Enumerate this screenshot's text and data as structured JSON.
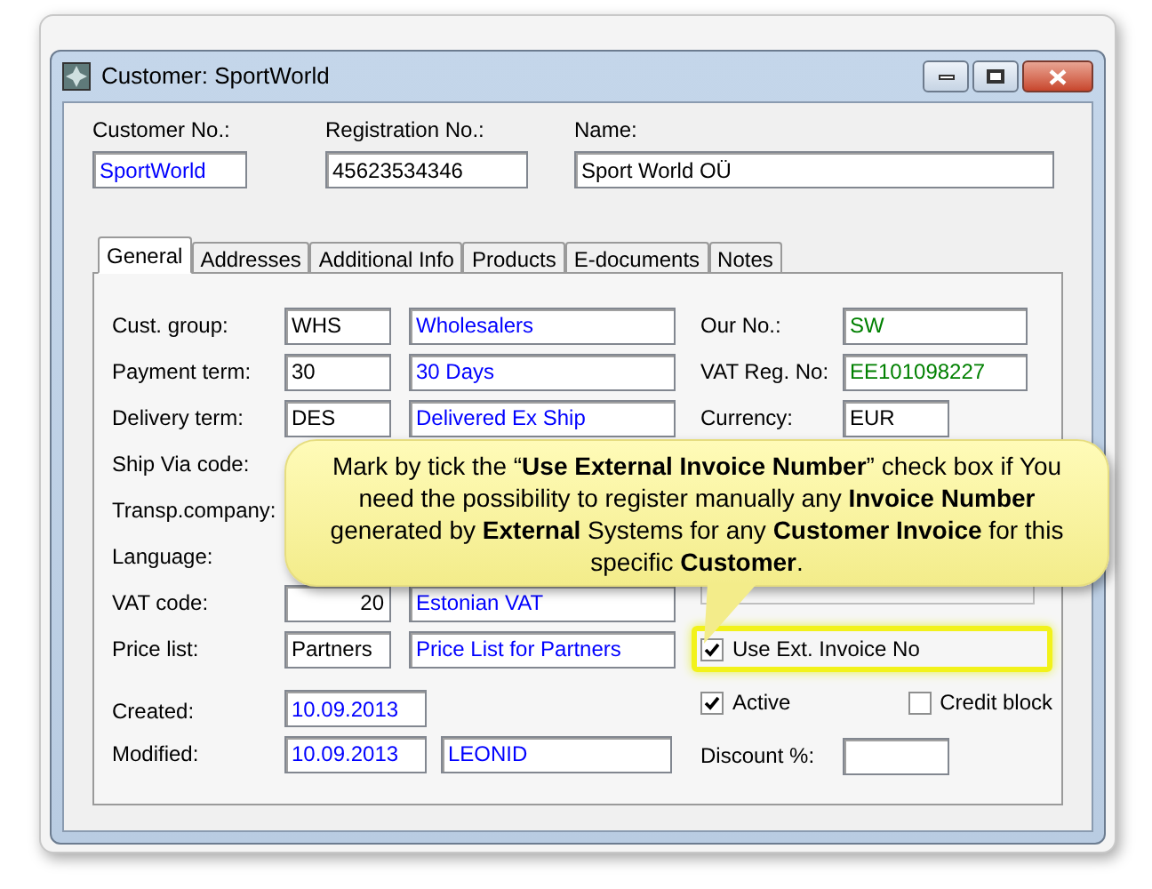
{
  "window": {
    "title": "Customer: SportWorld"
  },
  "header_fields": [
    {
      "label": "Customer No.:",
      "value": "SportWorld",
      "color": "#0000ff"
    },
    {
      "label": "Registration No.:",
      "value": "45623534346",
      "color": "#000000"
    },
    {
      "label": "Name:",
      "value": "Sport World OÜ",
      "color": "#000000"
    }
  ],
  "tabs": [
    {
      "label": "General",
      "selected": true
    },
    {
      "label": "Addresses",
      "selected": false
    },
    {
      "label": "Additional Info",
      "selected": false
    },
    {
      "label": "Products",
      "selected": false
    },
    {
      "label": "E-documents",
      "selected": false
    },
    {
      "label": "Notes",
      "selected": false
    }
  ],
  "left_rows": [
    {
      "label": "Cust. group:",
      "code": {
        "value": "WHS",
        "color": "#000000"
      },
      "description": {
        "value": "Wholesalers",
        "color": "#0000ff"
      }
    },
    {
      "label": "Payment term:",
      "code": {
        "value": "30",
        "color": "#000000"
      },
      "description": {
        "value": "30 Days",
        "color": "#0000ff"
      }
    },
    {
      "label": "Delivery term:",
      "code": {
        "value": "DES",
        "color": "#000000"
      },
      "description": {
        "value": "Delivered Ex Ship",
        "color": "#0000ff"
      }
    },
    {
      "label": "Ship Via code:"
    },
    {
      "label": "Transp.company:"
    },
    {
      "label": "Language:"
    },
    {
      "label": "VAT code:",
      "code": {
        "value": "20",
        "color": "#000000",
        "kind": "number"
      },
      "description": {
        "value": "Estonian VAT",
        "color": "#0000ff"
      }
    },
    {
      "label": "Price list:",
      "code": {
        "value": "Partners",
        "color": "#000000"
      },
      "description": {
        "value": "Price List for Partners",
        "color": "#0000ff"
      }
    }
  ],
  "created": {
    "label": "Created:",
    "value": "10.09.2013"
  },
  "modified": {
    "label": "Modified:",
    "value": "10.09.2013",
    "user": "LEONID"
  },
  "right_fields": [
    {
      "label": "Our No.:",
      "value": "SW",
      "color": "#008000"
    },
    {
      "label": "VAT Reg. No:",
      "value": "EE101098227",
      "color": "#008000"
    },
    {
      "label": "Currency:",
      "value": "EUR",
      "color": "#000000"
    }
  ],
  "checkboxes": [
    {
      "label": "Use Ext. Invoice No",
      "checked": true,
      "highlighted": true
    },
    {
      "label": "Active",
      "checked": true,
      "highlighted": false
    },
    {
      "label": "Credit block",
      "checked": false,
      "highlighted": false
    }
  ],
  "discount": {
    "label": "Discount %:"
  },
  "callout": {
    "text": "Mark by tick the “**Use External Invoice Number**” check box if You need the possibility to register manually any **Invoice Number** generated by **External** Systems for any **Customer Invoice** for this specific **Customer**."
  }
}
